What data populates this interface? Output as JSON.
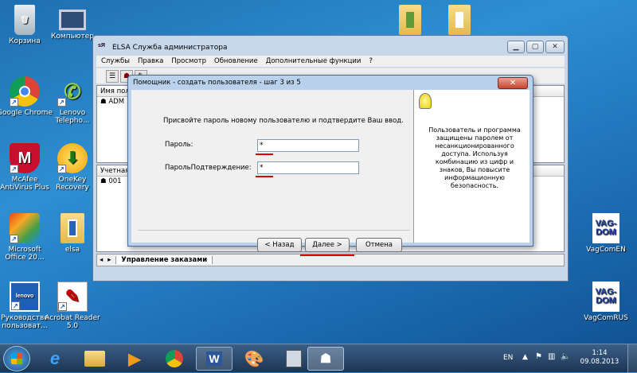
{
  "desktop_icons": [
    {
      "label": "Корзина",
      "icon": "recycle-bin-icon"
    },
    {
      "label": "Компьютер",
      "icon": "computer-icon"
    },
    {
      "label": "Google Chrome",
      "icon": "chrome-icon"
    },
    {
      "label": "Lenovo Telepho...",
      "icon": "lenovo-phone-icon"
    },
    {
      "label": "McAfee AntiVirus Plus",
      "icon": "mcafee-icon"
    },
    {
      "label": "OneKey Recovery",
      "icon": "onekey-icon"
    },
    {
      "label": "Microsoft Office 20...",
      "icon": "office-icon"
    },
    {
      "label": "elsa",
      "icon": "folder-icon"
    },
    {
      "label": "Руководство пользоват...",
      "icon": "lenovo-guide-icon"
    },
    {
      "label": "Acrobat Reader 5.0",
      "icon": "acrobat-icon"
    },
    {
      "label": "VagComEN",
      "icon": "vagdom-icon"
    },
    {
      "label": "VagComRUS",
      "icon": "vagdom-icon"
    }
  ],
  "main_window": {
    "title": "ELSA Служба администратора",
    "menu": [
      "Службы",
      "Правка",
      "Просмотр",
      "Обновление",
      "Дополнительные функции",
      "?"
    ],
    "top_pane": {
      "header": "Имя пол",
      "row": "ADM"
    },
    "bottom_pane": {
      "header": "Учетная",
      "row": "001"
    },
    "tab_label": "Управление заказами",
    "buttons": {
      "minimize": "▁",
      "maximize": "▢",
      "close": "✕"
    }
  },
  "dialog": {
    "title": "Помощник - создать пользователя - шаг 3 из 5",
    "instruction": "Присвойте пароль новому пользователю и подтвердите Ваш ввод.",
    "password_label": "Пароль:",
    "password_value": "*",
    "confirm_label": "ПарольПодтверждение:",
    "confirm_value": "*",
    "back_button": "< Назад",
    "next_button": "Далее >",
    "cancel_button": "Отмена",
    "help_text": "Пользователь и программа защищены паролем от несанкционированного доступа. Используя комбинацию из цифр и знаков, Вы повысите информационную безопасность.",
    "close": "✕"
  },
  "taskbar": {
    "language": "EN",
    "time": "1:14",
    "date": "09.08.2013"
  },
  "colors": {
    "highlight": "#e00000",
    "dialog_frame": "#b9d1ea"
  }
}
